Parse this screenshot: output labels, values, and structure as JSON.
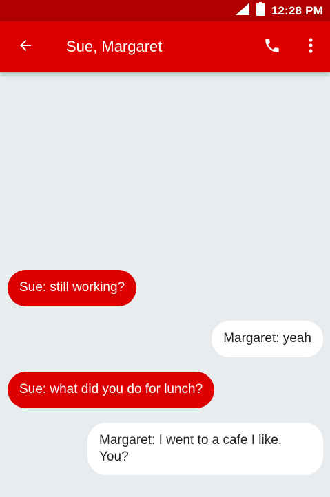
{
  "status_bar": {
    "time": "12:28 PM",
    "background": "#b00000"
  },
  "app_bar": {
    "title": "Sue, Margaret",
    "background": "#dd0000",
    "icons": {
      "back": "arrow-back-icon",
      "call": "phone-icon",
      "more": "more-vert-icon"
    }
  },
  "conversation": {
    "background": "#e9ecef",
    "messages": [
      {
        "direction": "incoming",
        "text": "Sue: still working?"
      },
      {
        "direction": "outgoing",
        "text": "Margaret: yeah"
      },
      {
        "direction": "incoming",
        "text": "Sue: what did you do for lunch?"
      },
      {
        "direction": "outgoing",
        "text": "Margaret: I went to a cafe I like. You?"
      }
    ]
  }
}
